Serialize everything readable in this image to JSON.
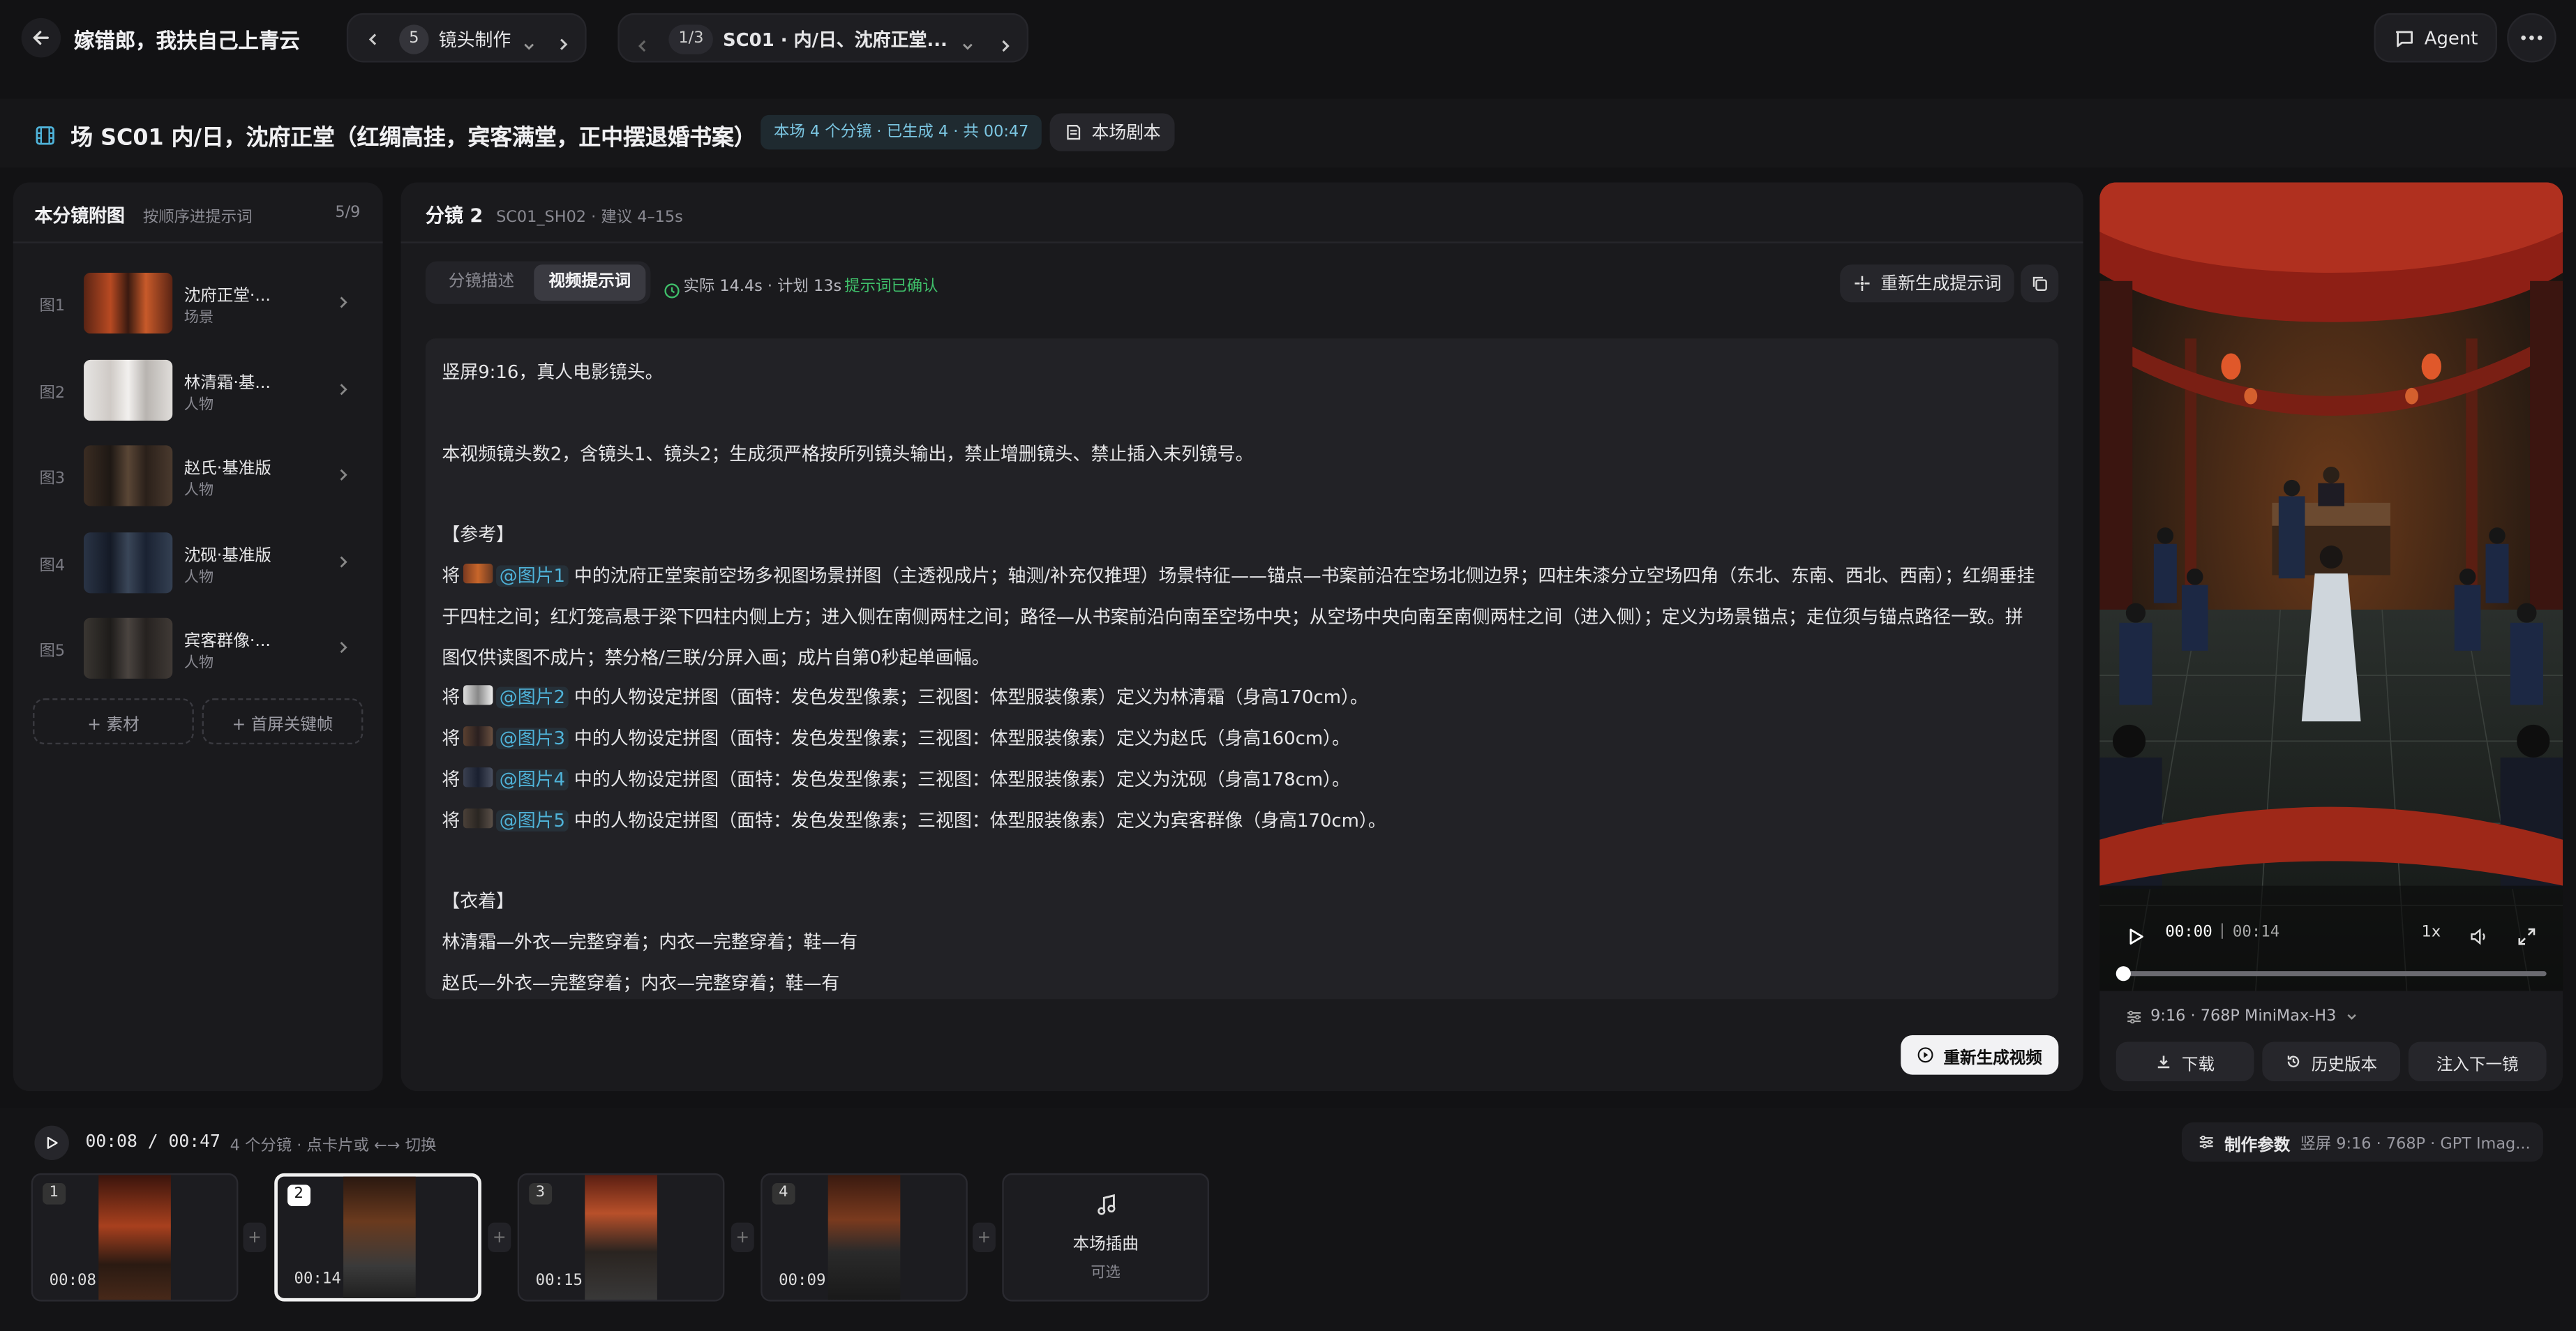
{
  "topbar": {
    "project_title": "嫁错郎，我扶自己上青云",
    "step_number": "5",
    "step_label": "镜头制作",
    "scene_counter": "1/3",
    "scene_label": "SC01 · 内/日、沈府正堂...",
    "agent_label": "Agent"
  },
  "scene_header": {
    "title": "场 SC01 内/日，沈府正堂（红绸高挂，宾客满堂，正中摆退婚书案）",
    "badge": "本场 4 个分镜 · 已生成 4 · 共 00:47",
    "script_button": "本场剧本"
  },
  "sidebar": {
    "title": "本分镜附图",
    "subtitle": "按顺序进提示词",
    "count": "5/9",
    "items": [
      {
        "index": "图1",
        "name": "沈府正堂·...",
        "type": "场景"
      },
      {
        "index": "图2",
        "name": "林清霜·基...",
        "type": "人物"
      },
      {
        "index": "图3",
        "name": "赵氏·基准版",
        "type": "人物"
      },
      {
        "index": "图4",
        "name": "沈砚·基准版",
        "type": "人物"
      },
      {
        "index": "图5",
        "name": "宾客群像·...",
        "type": "人物"
      }
    ],
    "add_material": "+ 素材",
    "add_keyframe": "+ 首屏关键帧"
  },
  "shot": {
    "title": "分镜 2",
    "meta": "SC01_SH02 · 建议 4–15s",
    "tab_desc": "分镜描述",
    "tab_prompt": "视频提示词",
    "timing": "实际 14.4s · 计划 13s",
    "confirmed": "提示词已确认",
    "regen_prompt": "重新生成提示词",
    "regen_video": "重新生成视频"
  },
  "prompt": {
    "line1": "竖屏9:16，真人电影镜头。",
    "line2": "本视频镜头数2，含镜头1、镜头2；生成须严格按所列镜头输出，禁止增删镜头、禁止插入未列镜号。",
    "ref_head": "【参考】",
    "ref1_pre": "将",
    "ref1_tag": "@图片1",
    "ref1_body": "中的沈府正堂案前空场多视图场景拼图（主透视成片；轴测/补充仅推理）场景特征——锚点—书案前沿在空场北侧边界；四柱朱漆分立空场四角（东北、东南、西北、西南）；红绸垂挂",
    "ref1_cont1": "于四柱之间；红灯笼高悬于梁下四柱内侧上方；进入侧在南侧两柱之间；路径—从书案前沿向南至空场中央；从空场中央向南至南侧两柱之间（进入侧）；定义为场景锚点；走位须与锚点路径一致。拼",
    "ref1_cont2": "图仅供读图不成片；禁分格/三联/分屏入画；成片自第0秒起单画幅。",
    "ref2_pre": "将",
    "ref2_tag": "@图片2",
    "ref2_body": "中的人物设定拼图（面特：发色发型像素；三视图：体型服装像素）定义为林清霜（身高170cm）。",
    "ref3_pre": "将",
    "ref3_tag": "@图片3",
    "ref3_body": "中的人物设定拼图（面特：发色发型像素；三视图：体型服装像素）定义为赵氏（身高160cm）。",
    "ref4_pre": "将",
    "ref4_tag": "@图片4",
    "ref4_body": "中的人物设定拼图（面特：发色发型像素；三视图：体型服装像素）定义为沈砚（身高178cm）。",
    "ref5_pre": "将",
    "ref5_tag": "@图片5",
    "ref5_body": "中的人物设定拼图（面特：发色发型像素；三视图：体型服装像素）定义为宾客群像（身高170cm）。",
    "cloth_head": "【衣着】",
    "cloth1": "林清霜—外衣—完整穿着；内衣—完整穿着；鞋—有",
    "cloth2": "赵氏—外衣—完整穿着；内衣—完整穿着；鞋—有"
  },
  "player": {
    "current": "00:00",
    "duration": "00:14",
    "speed": "1x",
    "progress": 0.0,
    "spec": "9:16 · 768P MiniMax-H3",
    "download": "下载",
    "history": "历史版本",
    "inject_next": "注入下一镜"
  },
  "timeline": {
    "time": "00:08 / 00:47",
    "hint": "4 个分镜 · 点卡片或 ←→ 切换",
    "params_label": "制作参数",
    "params_value": "竖屏 9:16 · 768P · GPT Imag...",
    "clips": [
      {
        "num": "1",
        "duration": "00:08"
      },
      {
        "num": "2",
        "duration": "00:14"
      },
      {
        "num": "3",
        "duration": "00:15"
      },
      {
        "num": "4",
        "duration": "00:09"
      }
    ],
    "music_label": "本场插曲",
    "music_sub": "可选"
  },
  "colors": {
    "accent": "#4fb3d9",
    "success": "#3fbf6a",
    "bg": "#121214",
    "panel": "#1a1a1d"
  },
  "icons": [
    "back-arrow-icon",
    "chevron-left-icon",
    "chevron-right-icon",
    "chevron-down-icon",
    "chat-icon",
    "more-icon",
    "film-icon",
    "script-icon",
    "sparkle-icon",
    "copy-icon",
    "clock-icon",
    "play-icon",
    "volume-icon",
    "fullscreen-icon",
    "settings-icon",
    "download-icon",
    "history-icon",
    "music-icon"
  ]
}
